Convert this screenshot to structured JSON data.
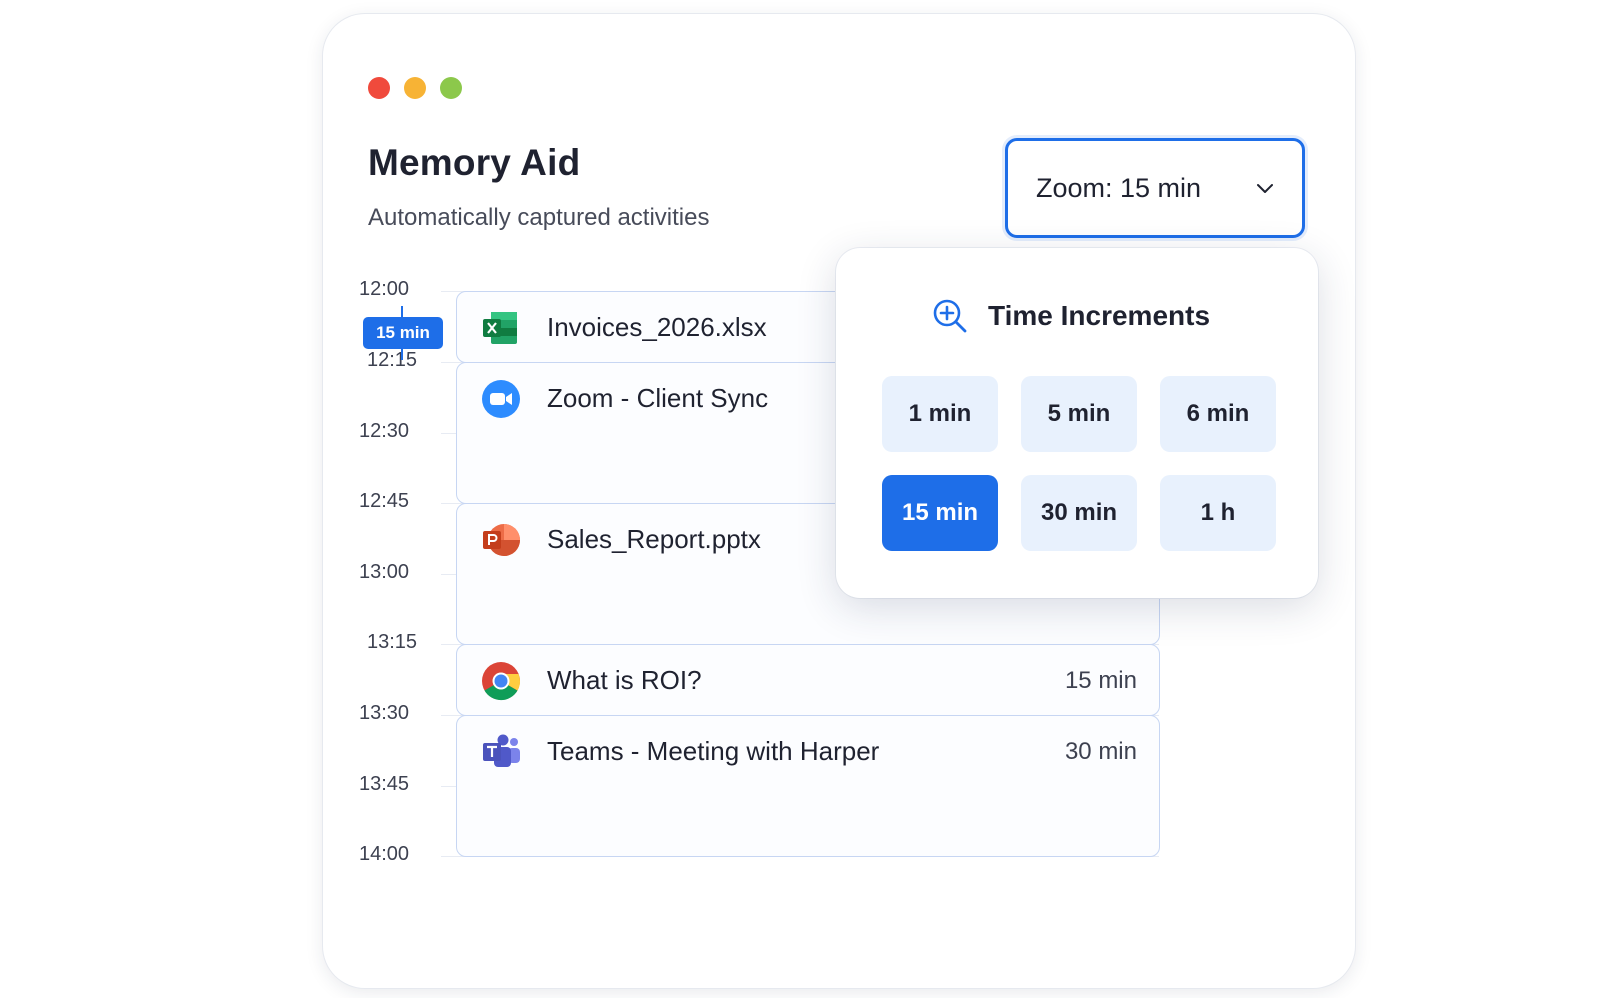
{
  "window": {
    "title": "Memory Aid",
    "subtitle": "Automatically captured activities"
  },
  "zoom_select": {
    "label": "Zoom: 15 min"
  },
  "timeline": {
    "times": [
      "12:00",
      "12:15",
      "12:30",
      "12:45",
      "13:00",
      "13:15",
      "13:30",
      "13:45",
      "14:00"
    ],
    "current_marker": "15 min"
  },
  "activities": [
    {
      "app": "excel-icon",
      "name": "Invoices_2026.xlsx",
      "duration": "",
      "start": "12:00",
      "end": "12:15"
    },
    {
      "app": "zoom-icon",
      "name": "Zoom - Client Sync",
      "duration": "",
      "start": "12:15",
      "end": "12:45"
    },
    {
      "app": "powerpoint-icon",
      "name": "Sales_Report.pptx",
      "duration": "",
      "start": "12:45",
      "end": "13:15"
    },
    {
      "app": "chrome-icon",
      "name": "What is ROI?",
      "duration": "15 min",
      "start": "13:15",
      "end": "13:30"
    },
    {
      "app": "teams-icon",
      "name": "Teams - Meeting with Harper",
      "duration": "30 min",
      "start": "13:30",
      "end": "14:00"
    }
  ],
  "popover": {
    "title": "Time Increments",
    "options": [
      "1 min",
      "5 min",
      "6 min",
      "15 min",
      "30 min",
      "1 h"
    ],
    "selected": "15 min"
  },
  "colors": {
    "accent": "#1e6ee8",
    "option_bg": "#e8f1fd",
    "dot_red": "#f04a3c",
    "dot_yellow": "#f7b335",
    "dot_green": "#8cc84b"
  }
}
